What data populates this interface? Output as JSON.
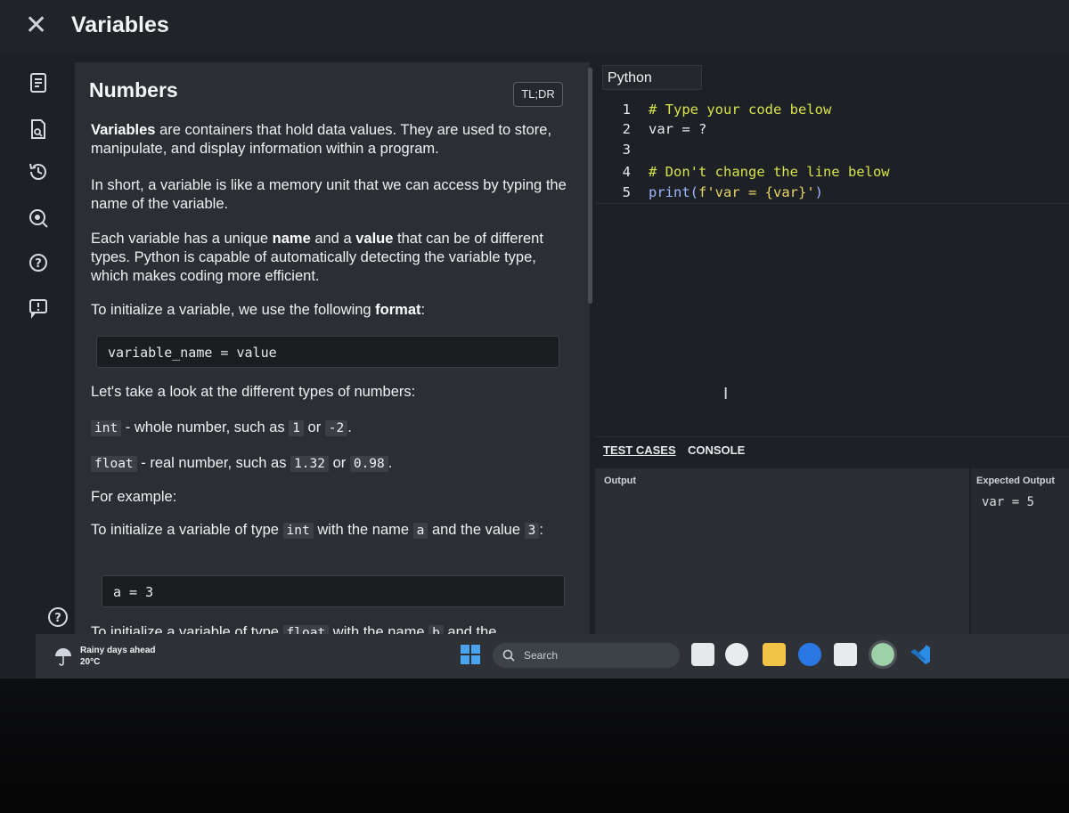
{
  "window": {
    "close_glyph": "✕",
    "title": "Variables"
  },
  "rail": {
    "icons": [
      "lesson-icon",
      "search-document-icon",
      "history-icon",
      "zoom-icon",
      "help-icon",
      "report-icon",
      "help-circle-icon"
    ]
  },
  "lesson": {
    "heading": "Numbers",
    "tldr_label": "TL;DR",
    "p1_bold": "Variables",
    "p1_rest": " are containers that hold data values. They are used to store, manipulate, and display information within a program.",
    "p2": "In short, a variable is like a memory unit that we can access by typing the name of the variable.",
    "p3_a": "Each variable has a unique ",
    "p3_name": "name",
    "p3_b": " and a ",
    "p3_value": "value",
    "p3_c": " that can be of different types. Python is capable of automatically detecting the variable type, which makes coding more efficient.",
    "p4_a": "To initialize a variable, we use the following ",
    "p4_format": "format",
    "p4_b": ":",
    "code1": "variable_name = value",
    "p5": "Let's take a look at the different types of numbers:",
    "int_kw": "int",
    "int_desc": " - whole number, such as ",
    "int_ex1": "1",
    "int_or": " or ",
    "int_ex2": "-2",
    "int_end": ".",
    "float_kw": "float",
    "float_desc": " - real number, such as ",
    "float_ex1": "1.32",
    "float_or": " or ",
    "float_ex2": "0.98",
    "float_end": ".",
    "p6": "For example:",
    "p7_a": "To initialize a variable of type ",
    "p7_type": "int",
    "p7_b": " with the name ",
    "p7_name": "a",
    "p7_c": " and the value ",
    "p7_val": "3",
    "p7_d": ":",
    "code2": "a = 3",
    "p8_a": "To initialize a variable of type ",
    "p8_type": "float",
    "p8_b": " with the name ",
    "p8_name": "b",
    "p8_c": " and the"
  },
  "editor": {
    "language": "Python",
    "lines": [
      {
        "n": "1",
        "text": "# Type your code below"
      },
      {
        "n": "2",
        "text": "var = ?"
      },
      {
        "n": "3",
        "text": ""
      },
      {
        "n": "4",
        "text": "# Don't change the line below"
      },
      {
        "n": "5",
        "print": "print(",
        "fstr": "f'var = {var}'",
        "close": ")"
      }
    ]
  },
  "bottom": {
    "tab_test_cases": "TEST CASES",
    "tab_console": "CONSOLE",
    "output_label": "Output",
    "expected_label": "Expected Output",
    "expected_value": "var = 5"
  },
  "taskbar": {
    "weather_title": "Rainy days ahead",
    "weather_temp": "20°C",
    "search_label": "Search",
    "colors": {
      "accent": "#2b78e4",
      "vscode": "#2a8ee6"
    }
  }
}
